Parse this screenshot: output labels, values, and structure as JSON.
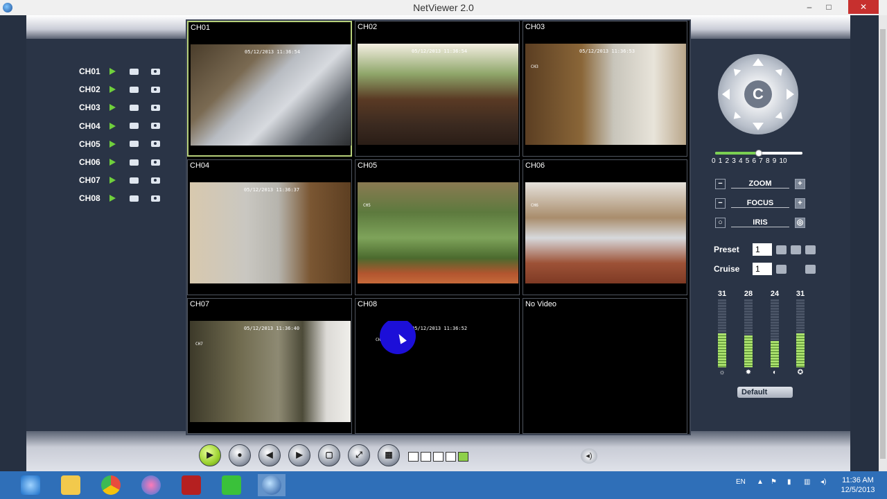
{
  "window": {
    "title": "NetViewer 2.0",
    "minimize": "–",
    "restore": "□",
    "close": "✕"
  },
  "channels": [
    {
      "label": "CH01"
    },
    {
      "label": "CH02"
    },
    {
      "label": "CH03"
    },
    {
      "label": "CH04"
    },
    {
      "label": "CH05"
    },
    {
      "label": "CH06"
    },
    {
      "label": "CH07"
    },
    {
      "label": "CH08"
    }
  ],
  "grid": {
    "cells": [
      {
        "label": "CH01",
        "timestamp": "05/12/2013 11:36:54",
        "tag": ""
      },
      {
        "label": "CH02",
        "timestamp": "05/12/2013 11:36:54",
        "tag": ""
      },
      {
        "label": "CH03",
        "timestamp": "05/12/2013 11:36:53",
        "tag": "CH3"
      },
      {
        "label": "CH04",
        "timestamp": "05/12/2013 11:36:37",
        "tag": ""
      },
      {
        "label": "CH05",
        "timestamp": "",
        "tag": "CH5"
      },
      {
        "label": "CH06",
        "timestamp": "",
        "tag": "CH6"
      },
      {
        "label": "CH07",
        "timestamp": "05/12/2013 11:36:40",
        "tag": "CH7"
      },
      {
        "label": "CH08",
        "timestamp": "05/12/2013 11:36:52",
        "tag": "CH8"
      },
      {
        "label": "No Video",
        "timestamp": "",
        "tag": ""
      }
    ]
  },
  "ptz": {
    "center_glyph": "C"
  },
  "speed": {
    "value": 5,
    "scale": [
      "0",
      "1",
      "2",
      "3",
      "4",
      "5",
      "6",
      "7",
      "8",
      "9",
      "10"
    ]
  },
  "lens": [
    {
      "name": "ZOOM"
    },
    {
      "name": "FOCUS"
    },
    {
      "name": "IRIS"
    }
  ],
  "preset": {
    "label": "Preset",
    "value": "1"
  },
  "cruise": {
    "label": "Cruise",
    "value": "1"
  },
  "meters": [
    {
      "value": "31",
      "icon": "brightness-icon",
      "level": 0.5
    },
    {
      "value": "28",
      "icon": "sun-icon",
      "level": 0.47
    },
    {
      "value": "24",
      "icon": "contrast-icon",
      "level": 0.39
    },
    {
      "value": "31",
      "icon": "saturation-icon",
      "level": 0.5
    }
  ],
  "default_button": "Default",
  "taskbar": {
    "lang": "EN",
    "time": "11:36 AM",
    "date": "12/5/2013"
  }
}
